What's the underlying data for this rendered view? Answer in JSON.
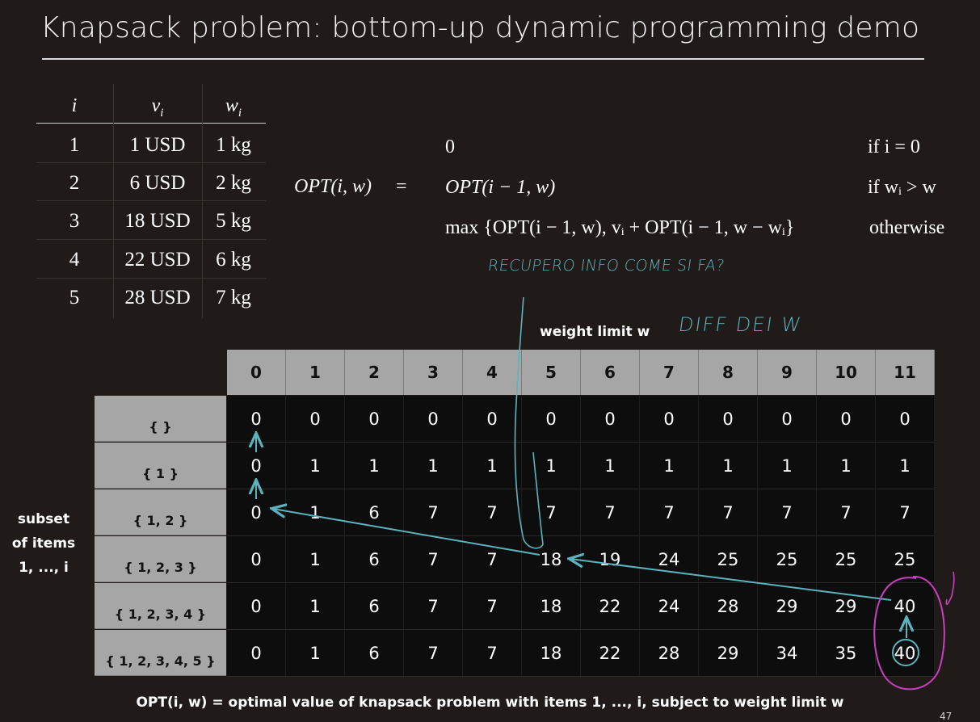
{
  "slide": {
    "title": "Knapsack problem:  bottom-up dynamic programming demo",
    "footer": "OPT(i, w) = optimal value of knapsack problem with items 1, ..., i, subject to weight limit w",
    "page_number": "47"
  },
  "items_table": {
    "headers": [
      "i",
      "v",
      "w"
    ],
    "header_subscript": "i",
    "rows": [
      {
        "i": "1",
        "v": "1 USD",
        "w": "1 kg"
      },
      {
        "i": "2",
        "v": "6 USD",
        "w": "2 kg"
      },
      {
        "i": "3",
        "v": "18 USD",
        "w": "5 kg"
      },
      {
        "i": "4",
        "v": "22 USD",
        "w": "6 kg"
      },
      {
        "i": "5",
        "v": "28 USD",
        "w": "7 kg"
      }
    ]
  },
  "recurrence": {
    "lhs": "OPT(i, w)",
    "equals": "=",
    "cases": [
      {
        "expr": "0",
        "cond": "if i = 0"
      },
      {
        "expr": "OPT(i − 1, w)",
        "cond": "if wᵢ > w"
      },
      {
        "expr": "max {OPT(i − 1, w), vᵢ + OPT(i − 1, w − wᵢ}",
        "cond": "otherwise"
      }
    ]
  },
  "annotations": {
    "note_1": "RECUPERO INFO COME SI FA?",
    "note_2": "DIFF DEI W",
    "color_ink_teal": "#5ab3bd",
    "color_ink_magenta": "#c93ec0"
  },
  "dp_table": {
    "column_axis_label": "weight limit w",
    "row_axis_label": "subset of items 1, ..., i",
    "row_axis_lines": [
      "subset",
      "of items",
      "1, ..., i"
    ],
    "columns": [
      "0",
      "1",
      "2",
      "3",
      "4",
      "5",
      "6",
      "7",
      "8",
      "9",
      "10",
      "11"
    ],
    "rows": [
      {
        "label": "{ }",
        "values": [
          "0",
          "0",
          "0",
          "0",
          "0",
          "0",
          "0",
          "0",
          "0",
          "0",
          "0",
          "0"
        ]
      },
      {
        "label": "{ 1 }",
        "values": [
          "0",
          "1",
          "1",
          "1",
          "1",
          "1",
          "1",
          "1",
          "1",
          "1",
          "1",
          "1"
        ]
      },
      {
        "label": "{ 1, 2 }",
        "values": [
          "0",
          "1",
          "6",
          "7",
          "7",
          "7",
          "7",
          "7",
          "7",
          "7",
          "7",
          "7"
        ]
      },
      {
        "label": "{ 1, 2, 3 }",
        "values": [
          "0",
          "1",
          "6",
          "7",
          "7",
          "18",
          "19",
          "24",
          "25",
          "25",
          "25",
          "25"
        ]
      },
      {
        "label": "{ 1, 2, 3, 4 }",
        "values": [
          "0",
          "1",
          "6",
          "7",
          "7",
          "18",
          "22",
          "24",
          "28",
          "29",
          "29",
          "40"
        ]
      },
      {
        "label": "{ 1, 2, 3, 4, 5 }",
        "values": [
          "0",
          "1",
          "6",
          "7",
          "7",
          "18",
          "22",
          "28",
          "29",
          "34",
          "35",
          "40"
        ]
      }
    ]
  },
  "colors": {
    "background": "#201b19",
    "header_fill": "#a6a6a6",
    "cell_fill": "#0d0d0d"
  }
}
